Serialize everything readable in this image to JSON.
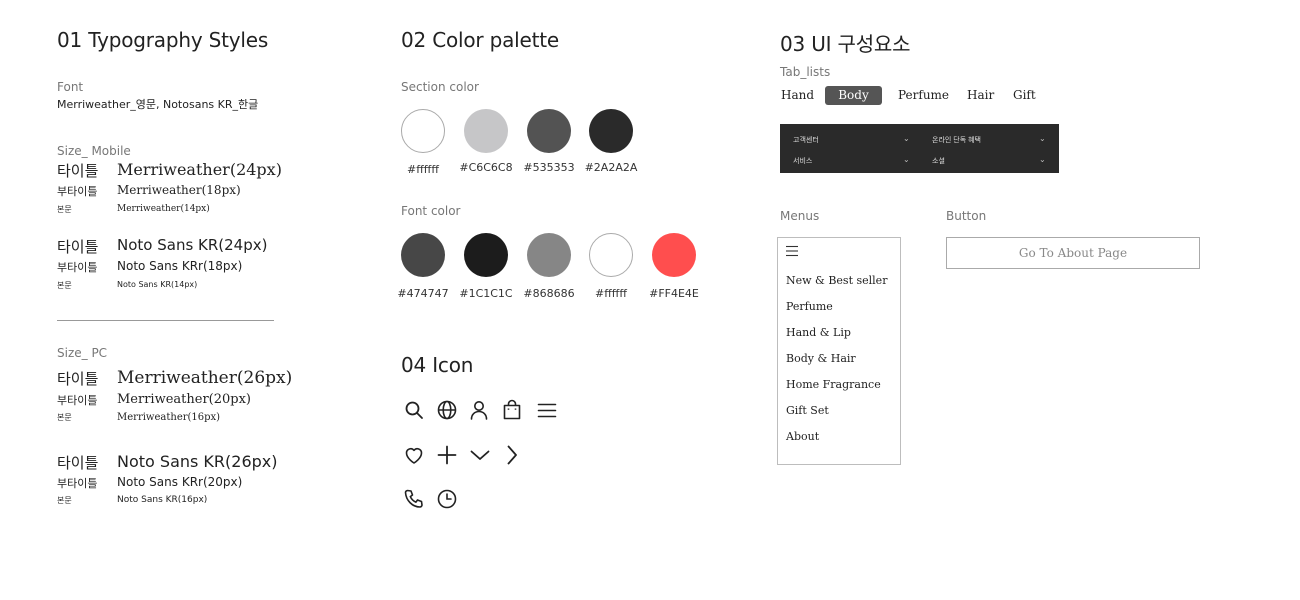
{
  "sections": {
    "typography": "01 Typography Styles",
    "colors": "02 Color palette",
    "ui": "03 UI 구성요소",
    "icons": "04 Icon"
  },
  "typography": {
    "font_label": "Font",
    "font_value": "Merriweather_영문, Notosans KR_한글",
    "mobile_label": "Size_ Mobile",
    "pc_label": "Size_ PC",
    "mobile_merri": [
      {
        "k": "타이틀",
        "v": "Merriweather(24px)"
      },
      {
        "k": "부타이틀",
        "v": "Merriweather(18px)"
      },
      {
        "k": "본문",
        "v": "Merriweather(14px)"
      }
    ],
    "mobile_noto": [
      {
        "k": "타이틀",
        "v": "Noto Sans KR(24px)"
      },
      {
        "k": "부타이틀",
        "v": "Noto Sans KRr(18px)"
      },
      {
        "k": "본문",
        "v": "Noto Sans KR(14px)"
      }
    ],
    "pc_merri": [
      {
        "k": "타이틀",
        "v": "Merriweather(26px)"
      },
      {
        "k": "부타이틀",
        "v": "Merriweather(20px)"
      },
      {
        "k": "본문",
        "v": "Merriweather(16px)"
      }
    ],
    "pc_noto": [
      {
        "k": "타이틀",
        "v": "Noto Sans KR(26px)"
      },
      {
        "k": "부타이틀",
        "v": "Noto Sans KRr(20px)"
      },
      {
        "k": "본문",
        "v": "Noto Sans KR(16px)"
      }
    ]
  },
  "palette": {
    "section_label": "Section color",
    "font_label": "Font color",
    "section_colors": [
      {
        "label": "#ffffff",
        "hex": "#ffffff"
      },
      {
        "label": "#C6C6C8",
        "hex": "#C6C6C8"
      },
      {
        "label": "#535353",
        "hex": "#535353"
      },
      {
        "label": "#2A2A2A",
        "hex": "#2A2A2A"
      }
    ],
    "font_colors": [
      {
        "label": "#474747",
        "hex": "#474747"
      },
      {
        "label": "#1C1C1C",
        "hex": "#1C1C1C"
      },
      {
        "label": "#868686",
        "hex": "#868686"
      },
      {
        "label": "#ffffff",
        "hex": "#ffffff"
      },
      {
        "label": "#FF4E4E",
        "hex": "#FF4E4E"
      }
    ]
  },
  "icons": [
    "search-icon",
    "globe-icon",
    "user-icon",
    "shopping-bag-icon",
    "menu-icon",
    "heart-icon",
    "plus-icon",
    "chevron-down-icon",
    "chevron-right-icon",
    "phone-icon",
    "clock-icon"
  ],
  "ui": {
    "tab_lists_label": "Tab_lists",
    "tabs": [
      "Hand",
      "Body",
      "Perfume",
      "Hair",
      "Gift"
    ],
    "active_tab": "Body",
    "footer_items": [
      "고객센터",
      "온라인 단독 혜택",
      "서비스",
      "소셜"
    ],
    "menus_label": "Menus",
    "button_label": "Button",
    "menu_items": [
      "New & Best seller",
      "Perfume",
      "Hand & Lip",
      "Body & Hair",
      "Home Fragrance",
      "Gift Set",
      "About"
    ],
    "button_text": "Go To About Page"
  }
}
